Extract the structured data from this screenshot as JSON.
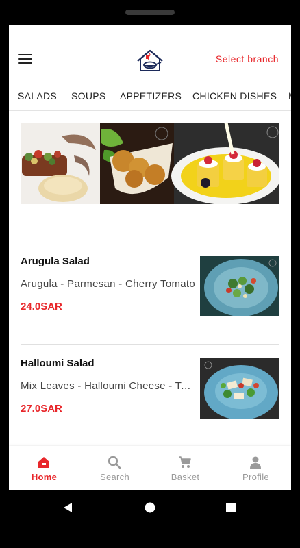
{
  "header": {
    "select_branch": "Select branch"
  },
  "tabs": [
    {
      "label": "SALADS",
      "active": true
    },
    {
      "label": "SOUPS"
    },
    {
      "label": "APPETIZERS"
    },
    {
      "label": "CHICKEN DISHES"
    },
    {
      "label": "M"
    }
  ],
  "items": [
    {
      "name": "Arugula Salad",
      "description": "Arugula - Parmesan - Cherry Tomato",
      "price": "24.0SAR"
    },
    {
      "name": "Halloumi Salad",
      "description": "Mix Leaves - Halloumi Cheese - Tomato",
      "price": "27.0SAR"
    }
  ],
  "bottom_nav": [
    {
      "label": "Home",
      "icon": "home-icon",
      "active": true
    },
    {
      "label": "Search",
      "icon": "search-icon"
    },
    {
      "label": "Basket",
      "icon": "basket-icon"
    },
    {
      "label": "Profile",
      "icon": "profile-icon"
    }
  ],
  "colors": {
    "accent": "#e8272b",
    "inactive": "#9a9a9a",
    "plate_blue": "#6fa9c4"
  }
}
